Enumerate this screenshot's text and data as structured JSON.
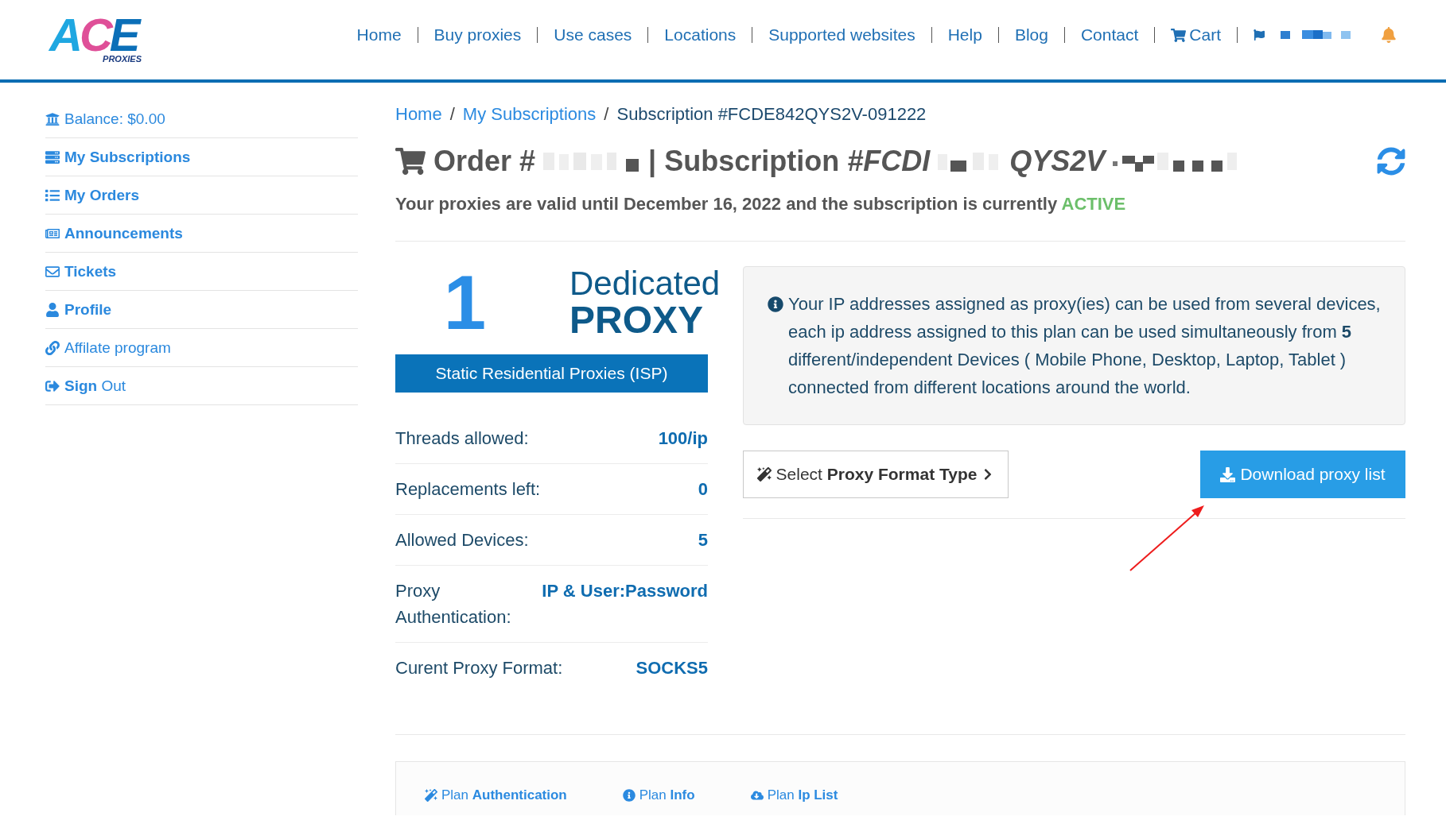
{
  "header": {
    "logo": {
      "wordmark": "ACE",
      "tagline": "PROXIES"
    },
    "nav": [
      {
        "label": "Home",
        "kind": "link"
      },
      {
        "label": "Buy proxies",
        "kind": "link"
      },
      {
        "label": "Use cases",
        "kind": "link"
      },
      {
        "label": "Locations",
        "kind": "link"
      },
      {
        "label": "Supported websites",
        "kind": "link"
      },
      {
        "label": "Help",
        "kind": "link"
      },
      {
        "label": "Blog",
        "kind": "link"
      },
      {
        "label": "Contact",
        "kind": "link"
      },
      {
        "label": "Cart",
        "kind": "cart"
      }
    ]
  },
  "sidebar": {
    "items": [
      {
        "label": "Balance: $0.00",
        "bold": false
      },
      {
        "label": "My Subscriptions",
        "bold": true
      },
      {
        "label": "My Orders",
        "bold": true
      },
      {
        "label": "Announcements",
        "bold": true
      },
      {
        "label": "Tickets",
        "bold": true
      },
      {
        "label": "Profile",
        "bold": true
      },
      {
        "label": "Affilate program",
        "bold": false
      },
      {
        "label": "**Sign** Out",
        "bold": false
      }
    ]
  },
  "breadcrumb": {
    "separator": "/",
    "items": [
      {
        "label": "Home",
        "kind": "link"
      },
      {
        "label": "My Subscriptions",
        "kind": "link"
      },
      {
        "label": "Subscription #FCDE842QYS2V-091222",
        "kind": "current"
      }
    ]
  },
  "title": {
    "order": "Order #",
    "subscription": "| Subscription *#FCDI*",
    "code_tail": "QYS2V"
  },
  "validity": {
    "text": "Your proxies are valid until December 16, 2022 and the subscription is currently",
    "status": "ACTIVE"
  },
  "plan": {
    "count": "1",
    "headline_top": "Dedicated",
    "headline_bottom": "PROXY",
    "type": "Static Residential Proxies (ISP)",
    "details": [
      {
        "label": "Threads allowed:",
        "value": "100/ip"
      },
      {
        "label": "Replacements left:",
        "value": "0"
      },
      {
        "label": "Allowed Devices:",
        "value": "5"
      },
      {
        "label": "Proxy Authentication:",
        "value": "IP & User:Password"
      },
      {
        "label": "Curent Proxy Format:",
        "value": "SOCKS5"
      }
    ]
  },
  "notice": {
    "text": "Your IP addresses assigned as proxy(ies) can be used from several devices, each ip address assigned to this plan can be used simultaneously from **5** different/independent Devices ( Mobile Phone, Desktop, Laptop, Tablet ) connected from different locations around the world."
  },
  "actions": [
    {
      "label": "Select **Proxy Format Type**",
      "kind": "format"
    },
    {
      "label": "Download proxy list",
      "kind": "download"
    }
  ],
  "tabs": [
    {
      "label": "Plan **Authentication**"
    },
    {
      "label": "Plan **Info**"
    },
    {
      "label": "Plan **Ip List**"
    }
  ]
}
